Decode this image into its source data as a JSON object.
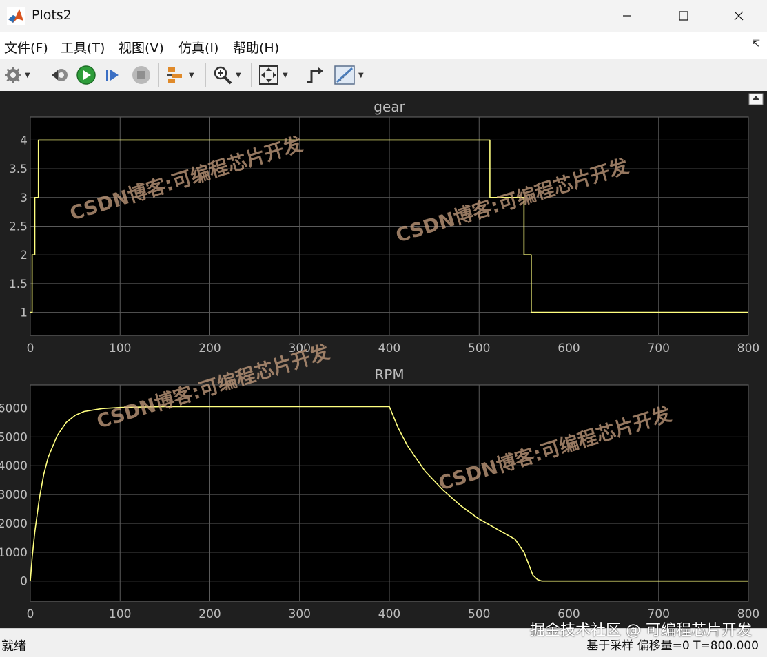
{
  "window": {
    "title": "Plots2"
  },
  "menu": {
    "items": [
      "文件(F)",
      "工具(T)",
      "视图(V)",
      "仿真(I)",
      "帮助(H)"
    ]
  },
  "toolbar": {
    "icons": [
      "gear-icon",
      "step-back-icon",
      "run-icon",
      "step-forward-icon",
      "stop-icon",
      "signal-select-icon",
      "zoom-icon",
      "fit-to-view-icon",
      "trigger-icon",
      "measure-icon"
    ]
  },
  "colors": {
    "plot_bg": "#000000",
    "figure_bg": "#1f1f1f",
    "grid": "#5a5a5a",
    "line": "#ffff80",
    "axis_text": "#bdbdbd",
    "watermark": "#c8a080"
  },
  "watermark_text": "CSDN博客:可编程芯片开发",
  "chart_data": [
    {
      "type": "line",
      "title": "gear",
      "xlim": [
        0,
        800
      ],
      "ylim": [
        0.6,
        4.4
      ],
      "xticks": [
        0,
        100,
        200,
        300,
        400,
        500,
        600,
        700,
        800
      ],
      "yticks": [
        1,
        1.5,
        2,
        2.5,
        3,
        3.5,
        4
      ],
      "ytick_labels": [
        "1",
        "1.5",
        "2",
        "2.5",
        "3",
        "3.5",
        "4"
      ],
      "grid": true,
      "series": [
        {
          "x": [
            0,
            2,
            2,
            5,
            5,
            9,
            9,
            512,
            512,
            550,
            550,
            558,
            558,
            800
          ],
          "values": [
            1,
            1,
            2,
            2,
            3,
            3,
            4,
            4,
            3,
            3,
            2,
            2,
            1,
            1
          ]
        }
      ]
    },
    {
      "type": "line",
      "title": "RPM",
      "xlim": [
        0,
        800
      ],
      "ylim": [
        -700,
        6800
      ],
      "xticks": [
        0,
        100,
        200,
        300,
        400,
        500,
        600,
        700,
        800
      ],
      "yticks": [
        0,
        1000,
        2000,
        3000,
        4000,
        5000,
        6000
      ],
      "ytick_labels": [
        "0",
        "1000",
        "2000",
        "3000",
        "4000",
        "5000",
        "6000"
      ],
      "grid": true,
      "series": [
        {
          "x": [
            0,
            2,
            5,
            10,
            15,
            20,
            30,
            40,
            50,
            60,
            80,
            100,
            150,
            200,
            300,
            400,
            410,
            420,
            440,
            460,
            480,
            500,
            520,
            540,
            550,
            555,
            560,
            565,
            570,
            580,
            600,
            700,
            800
          ],
          "values": [
            0,
            800,
            1700,
            2850,
            3700,
            4300,
            5050,
            5500,
            5750,
            5880,
            5980,
            6020,
            6050,
            6050,
            6050,
            6050,
            5300,
            4700,
            3800,
            3150,
            2600,
            2150,
            1800,
            1450,
            1000,
            600,
            200,
            50,
            0,
            0,
            0,
            0,
            0
          ]
        }
      ]
    }
  ],
  "status": {
    "left": "就绪",
    "right": "基于采样  偏移量=0  T=800.000",
    "site_watermark": "掘金技术社区 @ 可编程芯片开发"
  }
}
